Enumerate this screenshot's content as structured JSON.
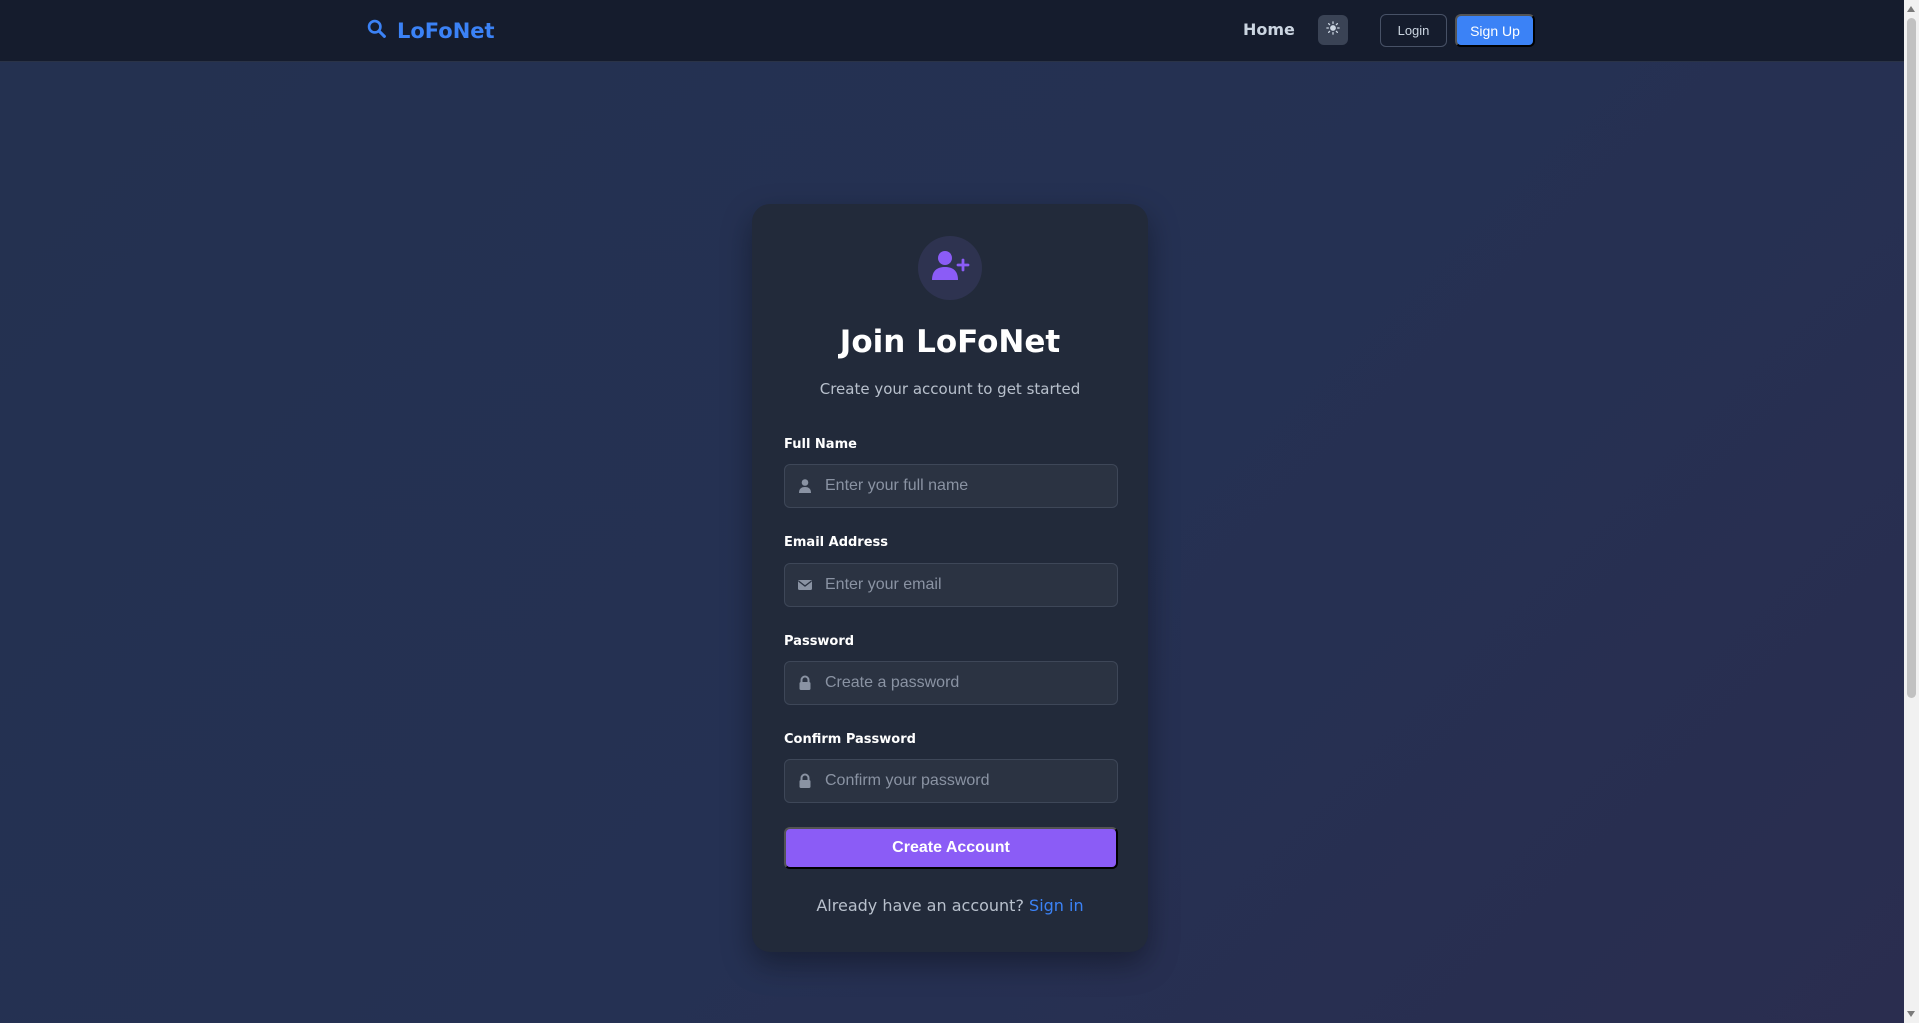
{
  "nav": {
    "brand": "LoFoNet",
    "home": "Home",
    "login": "Login",
    "signup": "Sign Up"
  },
  "card": {
    "title": "Join LoFoNet",
    "subtitle": "Create your account to get started",
    "fields": [
      {
        "label": "Full Name",
        "placeholder": "Enter your full name",
        "icon": "user-icon"
      },
      {
        "label": "Email Address",
        "placeholder": "Enter your email",
        "icon": "envelope-icon"
      },
      {
        "label": "Password",
        "placeholder": "Create a password",
        "icon": "lock-icon"
      },
      {
        "label": "Confirm Password",
        "placeholder": "Confirm your password",
        "icon": "lock-icon"
      }
    ],
    "submit": "Create Account",
    "footer_prompt": "Already have an account?",
    "footer_link": "Sign in"
  },
  "colors": {
    "brand": "#3b82f6",
    "accent": "#8b5cf6",
    "card_bg": "#222a3a",
    "nav_bg": "#151c2d"
  }
}
